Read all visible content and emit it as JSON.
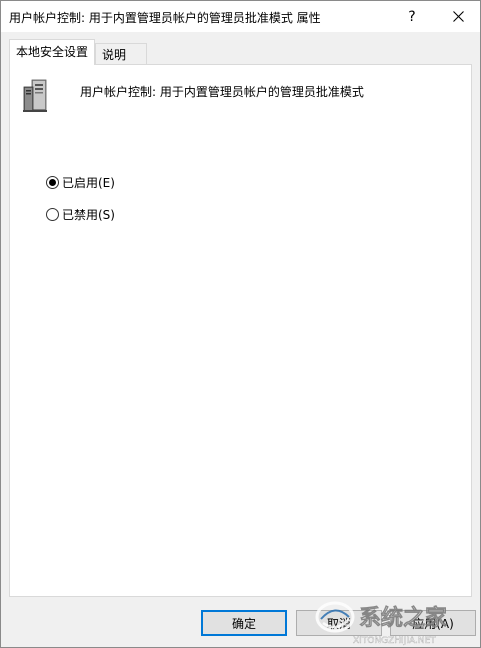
{
  "window": {
    "title": "用户帐户控制: 用于内置管理员帐户的管理员批准模式 属性",
    "help_label": "?",
    "close_icon": "close-icon"
  },
  "tabs": [
    {
      "label": "本地安全设置",
      "active": true
    },
    {
      "label": "说明",
      "active": false
    }
  ],
  "policy": {
    "icon": "server-icon",
    "title": "用户帐户控制: 用于内置管理员帐户的管理员批准模式"
  },
  "options": [
    {
      "label": "已启用(E)",
      "checked": true
    },
    {
      "label": "已禁用(S)",
      "checked": false
    }
  ],
  "buttons": {
    "ok": "确定",
    "cancel": "取消",
    "apply": "应用(A)"
  },
  "watermark": {
    "text": "系统之家",
    "url": "XITONGZHIJIA.NET"
  },
  "colors": {
    "accent": "#0078d7",
    "panel_bg": "#ffffff",
    "window_bg": "#f0f0f0"
  }
}
